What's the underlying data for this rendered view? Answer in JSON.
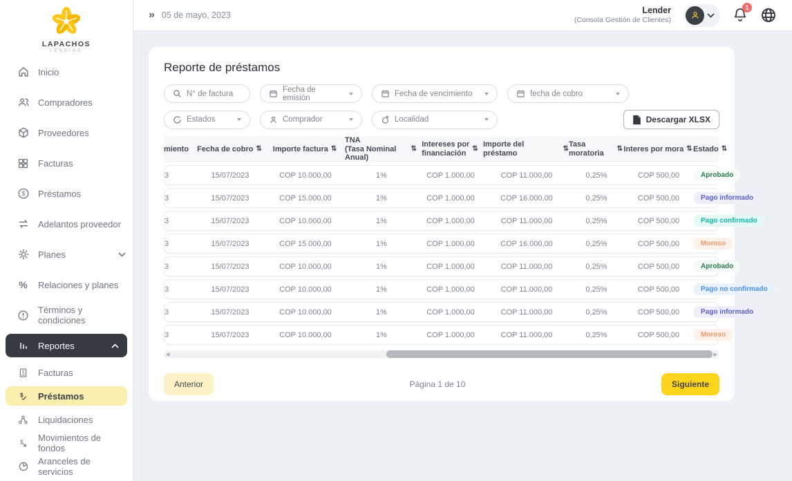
{
  "brand": {
    "name": "LAPACHOS",
    "tagline": "LENDING"
  },
  "topbar": {
    "date": "05 de mayo, 2023",
    "collapse_glyph": "»",
    "user_name": "Lender",
    "user_subtitle": "(Consola Gestión de Clientes)",
    "notification_count": "1"
  },
  "sidebar": {
    "items": [
      {
        "label": "Inicio"
      },
      {
        "label": "Compradores"
      },
      {
        "label": "Proveedores"
      },
      {
        "label": "Facturas"
      },
      {
        "label": "Préstamos"
      },
      {
        "label": "Adelantos proveedor"
      },
      {
        "label": "Planes"
      },
      {
        "label": "Relaciones y planes"
      },
      {
        "label": "Términos y condiciones"
      },
      {
        "label": "Reportes"
      },
      {
        "label": "Facturas"
      },
      {
        "label": "Préstamos"
      },
      {
        "label": "Liquidaciones"
      },
      {
        "label": "Movimientos de fondos"
      },
      {
        "label": "Aranceles de servicios"
      }
    ]
  },
  "main": {
    "title": "Reporte de préstamos",
    "filters": {
      "factura": "N° de factura",
      "emision": "Fecha de emisión",
      "vencimiento": "Fecha de vencimiento",
      "cobro": "fecha de cobro",
      "estados": "Estados",
      "comprador": "Comprador",
      "localidad": "Localidad"
    },
    "download_label": "Descargar XLSX",
    "pagination": {
      "prev": "Anterior",
      "info": "Página 1 de 10",
      "next": "Siguiente"
    }
  },
  "table": {
    "headers": [
      {
        "label": "miento",
        "sortable": false
      },
      {
        "label": "Fecha de cobro",
        "sortable": true
      },
      {
        "label": "Importe factura",
        "sortable": true
      },
      {
        "label": "TNA",
        "label2": "(Tasa Nominal Anual)",
        "sortable": true
      },
      {
        "label": "Intereses por",
        "label2": "financiación",
        "sortable": true
      },
      {
        "label": "Importe del préstamo",
        "sortable": true
      },
      {
        "label": "Tasa moratoria",
        "sortable": true
      },
      {
        "label": "Interes por mora",
        "sortable": true
      },
      {
        "label": "Estado",
        "sortable": true
      }
    ],
    "rows": [
      {
        "vencimiento": "3",
        "cobro": "15/07/2023",
        "importe_factura": "COP 10.000,00",
        "tna": "1%",
        "intereses": "COP 1.000,00",
        "prestamo": "COP 11.000,00",
        "tasa_moratoria": "0,25%",
        "interes_mora": "COP 500,00",
        "estado": "Aprobado",
        "estado_tipo": "aprobado"
      },
      {
        "vencimiento": "3",
        "cobro": "15/07/2023",
        "importe_factura": "COP 15.000,00",
        "tna": "1%",
        "intereses": "COP 1.000,00",
        "prestamo": "COP 16.000,00",
        "tasa_moratoria": "0,25%",
        "interes_mora": "COP 500,00",
        "estado": "Pago informado",
        "estado_tipo": "informado"
      },
      {
        "vencimiento": "3",
        "cobro": "15/07/2023",
        "importe_factura": "COP 10.000,00",
        "tna": "1%",
        "intereses": "COP 1.000,00",
        "prestamo": "COP 11.000,00",
        "tasa_moratoria": "0,25%",
        "interes_mora": "COP 500,00",
        "estado": "Pago confirmado",
        "estado_tipo": "confirmado"
      },
      {
        "vencimiento": "3",
        "cobro": "15/07/2023",
        "importe_factura": "COP 15.000,00",
        "tna": "1%",
        "intereses": "COP 1.000,00",
        "prestamo": "COP 16.000,00",
        "tasa_moratoria": "0,25%",
        "interes_mora": "COP 500,00",
        "estado": "Moroso",
        "estado_tipo": "moroso"
      },
      {
        "vencimiento": "3",
        "cobro": "15/07/2023",
        "importe_factura": "COP 10.000,00",
        "tna": "1%",
        "intereses": "COP 1.000,00",
        "prestamo": "COP 11.000,00",
        "tasa_moratoria": "0,25%",
        "interes_mora": "COP 500,00",
        "estado": "Aprobado",
        "estado_tipo": "aprobado"
      },
      {
        "vencimiento": "3",
        "cobro": "15/07/2023",
        "importe_factura": "COP 10.000,00",
        "tna": "1%",
        "intereses": "COP 1.000,00",
        "prestamo": "COP 11.000,00",
        "tasa_moratoria": "0,25%",
        "interes_mora": "COP 500,00",
        "estado": "Pago no confirmado",
        "estado_tipo": "no_confirmado"
      },
      {
        "vencimiento": "3",
        "cobro": "15/07/2023",
        "importe_factura": "COP 10.000,00",
        "tna": "1%",
        "intereses": "COP 1.000,00",
        "prestamo": "COP 11.000,00",
        "tasa_moratoria": "0,25%",
        "interes_mora": "COP 500,00",
        "estado": "Pago informado",
        "estado_tipo": "informado"
      },
      {
        "vencimiento": "3",
        "cobro": "15/07/2023",
        "importe_factura": "COP 10.000,00",
        "tna": "1%",
        "intereses": "COP 1.000,00",
        "prestamo": "COP 11.000,00",
        "tasa_moratoria": "0,25%",
        "interes_mora": "COP 500,00",
        "estado": "Moroso",
        "estado_tipo": "moroso"
      }
    ]
  },
  "colors": {
    "accent_yellow": "#FDD41C",
    "pale_yellow": "#FBF2C5",
    "sidebar_active_bg": "#363A42",
    "badge_red": "#F36B6B"
  }
}
